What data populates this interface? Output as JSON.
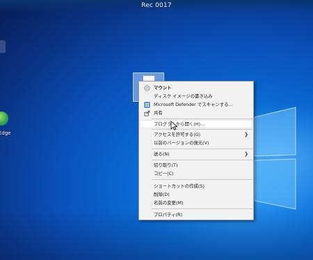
{
  "window": {
    "title": "Rec 0017"
  },
  "desktop": {
    "edge_label": "Edge"
  },
  "context_menu": {
    "items": [
      {
        "label": "マウント"
      },
      {
        "label": "ディスク イメージの書き込み"
      },
      {
        "label": "Microsoft Defender でスキャンする..."
      },
      {
        "label": "共有"
      },
      {
        "label": "プログラムから開く(H)..."
      },
      {
        "label": "アクセスを許可する(G)"
      },
      {
        "label": "以前のバージョンの復元(V)"
      },
      {
        "label": "送る(N)"
      },
      {
        "label": "切り取り(T)"
      },
      {
        "label": "コピー(C)"
      },
      {
        "label": "ショートカットの作成(S)"
      },
      {
        "label": "削除(D)"
      },
      {
        "label": "名前の変更(M)"
      },
      {
        "label": "プロパティ(R)"
      }
    ]
  },
  "icons": {
    "mount": "disc-icon",
    "defender": "defender-shield-icon",
    "share": "share-icon",
    "submenu": "chevron-right-icon"
  },
  "colors": {
    "menu_bg": "#f2f2f2",
    "desktop_accent": "#0b6fd8"
  }
}
